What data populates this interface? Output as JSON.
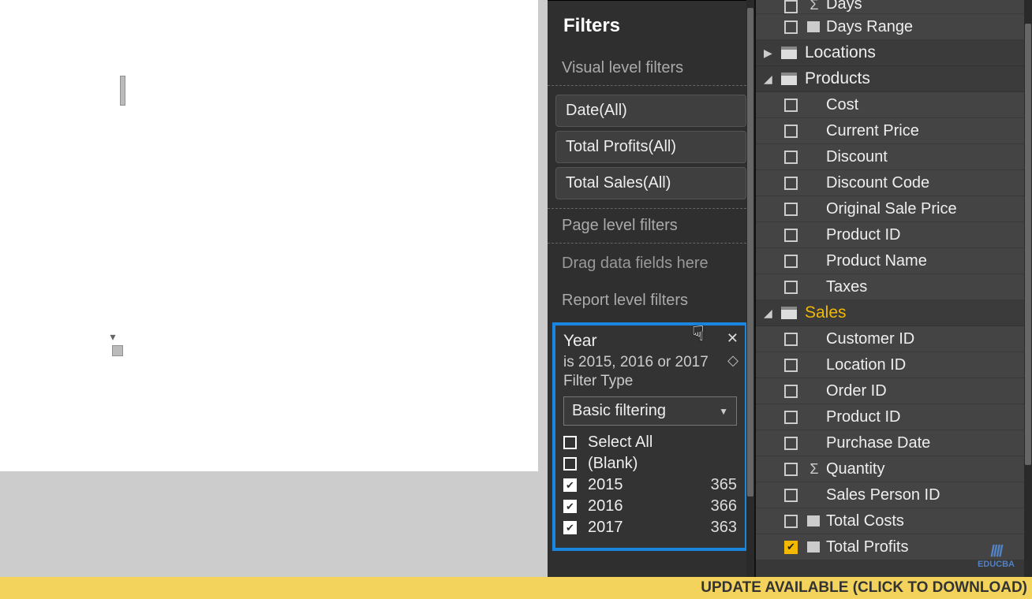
{
  "filters": {
    "title": "Filters",
    "visual_label": "Visual level filters",
    "visual_cards": [
      "Date(All)",
      "Total Profits(All)",
      "Total Sales(All)"
    ],
    "page_label": "Page level filters",
    "page_drop": "Drag data fields here",
    "report_label": "Report level filters",
    "year_filter": {
      "title": "Year",
      "summary": "is 2015, 2016 or 2017",
      "type_label": "Filter Type",
      "type_value": "Basic filtering",
      "options": [
        {
          "label": "Select All",
          "checked": false,
          "count": ""
        },
        {
          "label": "(Blank)",
          "checked": false,
          "count": ""
        },
        {
          "label": "2015",
          "checked": true,
          "count": "365"
        },
        {
          "label": "2016",
          "checked": true,
          "count": "366"
        },
        {
          "label": "2017",
          "checked": true,
          "count": "363"
        }
      ]
    }
  },
  "fields": {
    "top_fragments": [
      {
        "label": "Days",
        "sigma": true
      },
      {
        "label": "Days Range",
        "mini": true
      }
    ],
    "tables": [
      {
        "name": "Locations",
        "expanded": false,
        "selected": false,
        "fields": []
      },
      {
        "name": "Products",
        "expanded": true,
        "selected": false,
        "fields": [
          {
            "label": "Cost"
          },
          {
            "label": "Current Price"
          },
          {
            "label": "Discount"
          },
          {
            "label": "Discount Code"
          },
          {
            "label": "Original Sale Price"
          },
          {
            "label": "Product ID"
          },
          {
            "label": "Product Name"
          },
          {
            "label": "Taxes"
          }
        ]
      },
      {
        "name": "Sales",
        "expanded": true,
        "selected": true,
        "fields": [
          {
            "label": "Customer ID"
          },
          {
            "label": "Location ID"
          },
          {
            "label": "Order ID"
          },
          {
            "label": "Product ID"
          },
          {
            "label": "Purchase Date"
          },
          {
            "label": "Quantity",
            "sigma": true
          },
          {
            "label": "Sales Person ID"
          },
          {
            "label": "Total Costs",
            "mini": true
          },
          {
            "label": "Total Profits",
            "mini": true,
            "checked": true
          }
        ]
      }
    ]
  },
  "status_bar": "UPDATE AVAILABLE (CLICK TO DOWNLOAD)",
  "watermark": "EDUCBA"
}
